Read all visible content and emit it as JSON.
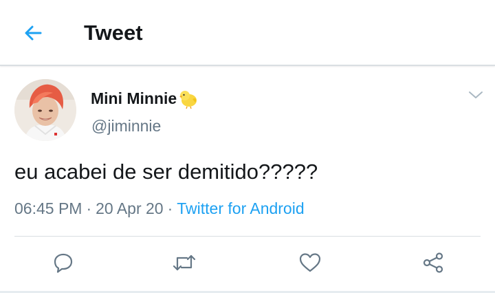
{
  "header": {
    "title": "Tweet",
    "back_icon": "arrow-left-icon"
  },
  "tweet": {
    "display_name": "Mini Minnie",
    "name_emoji": "chick-icon",
    "handle": "@jiminnie",
    "text": "eu acabei de ser demitido?????",
    "time": "06:45 PM",
    "separator": "·",
    "date": "20 Apr 20",
    "source": "Twitter for Android"
  },
  "actions": [
    {
      "name": "reply",
      "icon": "speech-bubble-icon"
    },
    {
      "name": "retweet",
      "icon": "retweet-icon"
    },
    {
      "name": "like",
      "icon": "heart-icon"
    },
    {
      "name": "share",
      "icon": "share-icon"
    }
  ],
  "colors": {
    "accent": "#1da1f2",
    "secondary_text": "#657786",
    "primary_text": "#14171a",
    "divider": "#d9dee2"
  }
}
